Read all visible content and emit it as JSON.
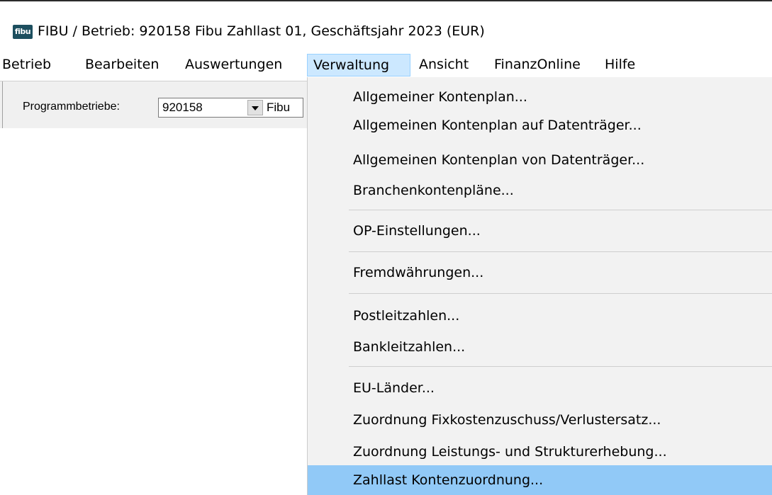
{
  "window": {
    "icon_text": "fibu",
    "title": "FIBU / Betrieb: 920158  Fibu Zahllast 01, Geschäftsjahr 2023 (EUR)"
  },
  "menubar": {
    "items": [
      "Betrieb",
      "Bearbeiten",
      "Auswertungen",
      "Verwaltung",
      "Ansicht",
      "FinanzOnline",
      "Hilfe"
    ],
    "active": "Verwaltung"
  },
  "toolbar": {
    "label": "Programmbetriebe:",
    "betrieb_value": "920158",
    "betrieb_name": "Fibu"
  },
  "dropdown": {
    "items": [
      "Allgemeiner Kontenplan...",
      "Allgemeinen Kontenplan auf Datenträger...",
      "Allgemeinen Kontenplan von Datenträger...",
      "Branchenkontenpläne...",
      "OP-Einstellungen...",
      "Fremdwährungen...",
      "Postleitzahlen...",
      "Bankleitzahlen...",
      "EU-Länder...",
      "Zuordnung Fixkostenzuschuss/Verlustersatz...",
      "Zuordnung Leistungs- und Strukturerhebung...",
      "Zahllast Kontenzuordnung..."
    ],
    "highlighted": "Zahllast Kontenzuordnung..."
  },
  "colors": {
    "menu_active_bg": "#cce8ff",
    "dropdown_highlight": "#91c9f7",
    "app_icon_bg": "#1d4f5f"
  }
}
